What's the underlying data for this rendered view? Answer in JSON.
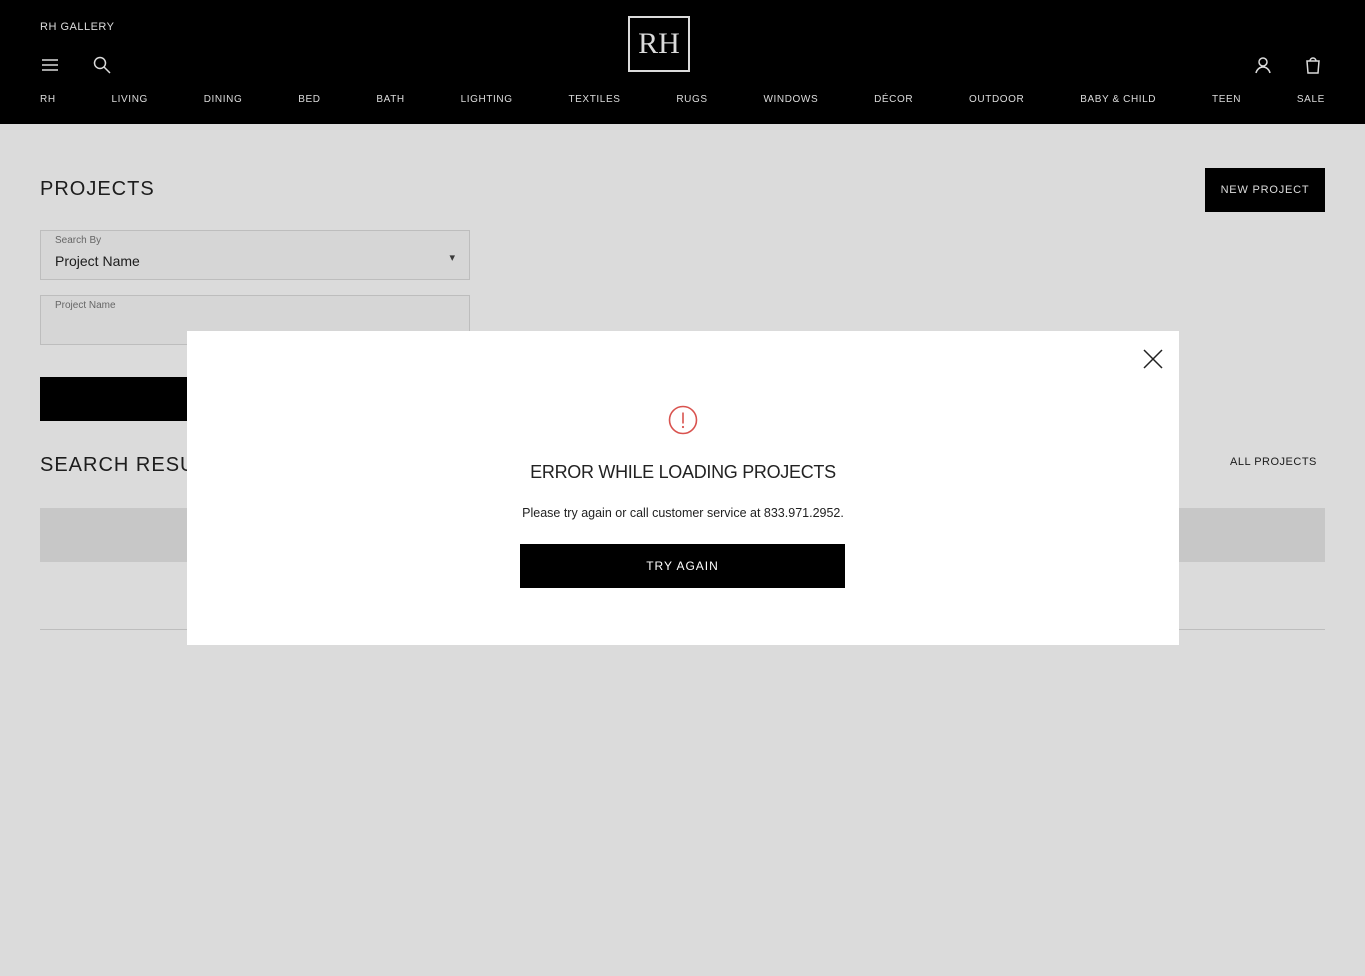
{
  "header": {
    "gallery_link": "RH GALLERY",
    "logo": "RH",
    "nav": [
      "RH",
      "LIVING",
      "DINING",
      "BED",
      "BATH",
      "LIGHTING",
      "TEXTILES",
      "RUGS",
      "WINDOWS",
      "DÉCOR",
      "OUTDOOR",
      "BABY & CHILD",
      "TEEN",
      "SALE"
    ],
    "icons": [
      "menu-icon",
      "search-icon",
      "account-icon",
      "cart-icon"
    ]
  },
  "page": {
    "title": "PROJECTS",
    "new_project_label": "NEW PROJECT",
    "search_by": {
      "label": "Search By",
      "value": "Project Name"
    },
    "project_name": {
      "label": "Project Name",
      "value": ""
    },
    "results_title": "SEARCH RESULTS",
    "all_projects_label": "ALL PROJECTS",
    "table": {
      "left_header": "",
      "right_header": ""
    },
    "row": {
      "line1": "",
      "line2": "",
      "line3": ""
    },
    "footer_links": [],
    "copyright": ""
  },
  "modal": {
    "title": "ERROR WHILE LOADING PROJECTS",
    "message": "Please try again or call customer service at 833.971.2952.",
    "button_label": "TRY AGAIN",
    "alert_color": "#d9534f"
  }
}
